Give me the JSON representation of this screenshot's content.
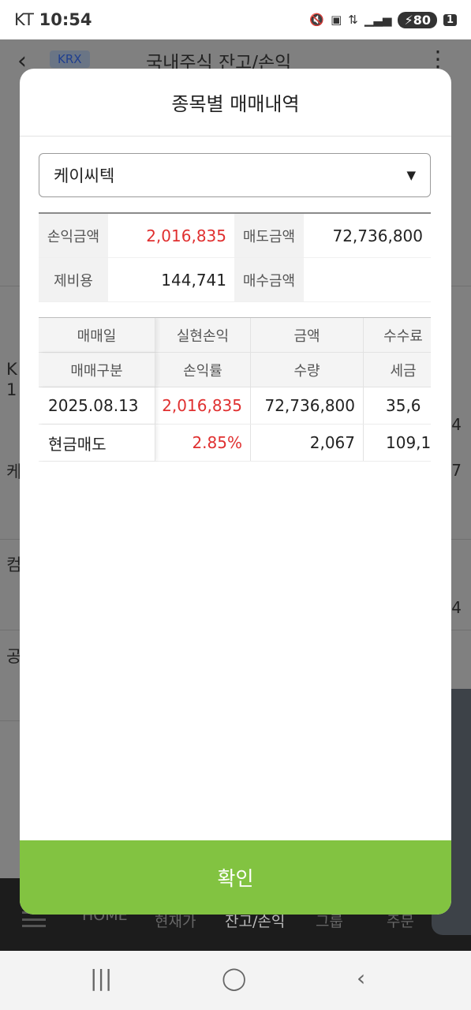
{
  "status": {
    "carrier": "KT",
    "time": "10:54",
    "battery": "80",
    "sim_badge": "1"
  },
  "background": {
    "badge": "KRX",
    "title": "국내주식 잔고/손익",
    "rows": [
      {
        "label": "K",
        "sub": "1",
        "value": "4"
      },
      {
        "label": "케",
        "value": "7"
      },
      {
        "label": "컴",
        "value": "4"
      },
      {
        "label": "공",
        "value": ""
      }
    ],
    "nav": [
      "HOME",
      "현재가",
      "잔고/손익",
      "그룹",
      "주문"
    ]
  },
  "modal": {
    "title": "종목별 매매내역",
    "selected_stock": "케이씨텍",
    "summary": [
      {
        "label": "손익금액",
        "value": "2,016,835",
        "label2": "매도금액",
        "value2": "72,736,800"
      },
      {
        "label": "제비용",
        "value": "144,741",
        "label2": "매수금액",
        "value2": ""
      }
    ],
    "table": {
      "header1": [
        "매매일",
        "실현손익",
        "금액",
        "수수료"
      ],
      "header2": [
        "매매구분",
        "손익률",
        "수량",
        "세금"
      ],
      "rows": [
        [
          "2025.08.13",
          "2,016,835",
          "72,736,800",
          "35,6"
        ],
        [
          "현금매도",
          "2.85%",
          "2,067",
          "109,1"
        ]
      ]
    },
    "confirm_label": "확인"
  },
  "colors": {
    "accent_green": "#82c341",
    "profit_red": "#e03030"
  },
  "icons": {
    "dropdown": "triangle-down-icon",
    "back": "chevron-left-icon",
    "more": "more-vertical-icon"
  }
}
